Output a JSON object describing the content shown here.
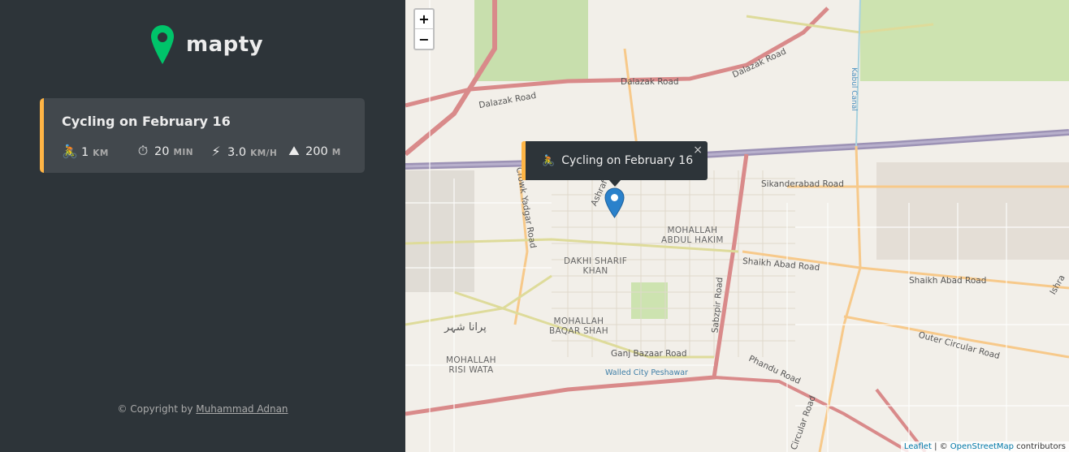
{
  "app": {
    "name": "mapty"
  },
  "workouts": [
    {
      "title": "Cycling on February 16",
      "type_icon": "🚴",
      "distance": {
        "icon": "🚴",
        "value": "1",
        "unit": "KM"
      },
      "duration": {
        "icon": "⏱",
        "value": "20",
        "unit": "MIN"
      },
      "speed": {
        "icon": "⚡",
        "value": "3.0",
        "unit": "KM/H"
      },
      "elevation": {
        "icon": "⛰",
        "value": "200",
        "unit": "M"
      }
    }
  ],
  "copyright": {
    "prefix": "© Copyright by",
    "author": "Muhammad Adnan"
  },
  "map": {
    "zoom_in": "+",
    "zoom_out": "−",
    "popup": {
      "icon": "🚴",
      "text": "Cycling on February 16",
      "close": "×"
    },
    "attribution": {
      "leaflet": "Leaflet",
      "sep": " | © ",
      "osm": "OpenStreetMap",
      "suffix": " contributors"
    },
    "labels": {
      "dalazak_road": "Dalazak Road",
      "dalazak_road_2": "Dalazak Road",
      "dalazak_road_3": "Dalazak Road",
      "kabul_canal": "Kabul Canal",
      "sikanderabad_road": "Sikanderabad Road",
      "shaikh_abad_road": "Shaikh Abad Road",
      "shaikh_abad_road_2": "Shaikh Abad Road",
      "outer_circular_road": "Outer Circular Road",
      "phandu_road": "Phandu Road",
      "ganj_bazaar_road": "Ganj Bazaar Road",
      "walled_city": "Walled City Peshawar",
      "sabzpir_road": "Sabzpir Road",
      "crown_yadgar_road": "Crowk Yadgar Road",
      "circular_road": "Circular Road",
      "mohallah_abdul_hakim": "MOHALLAH\nABDUL HAKIM",
      "dakhi_sharif_khan": "DAKHI SHARIF\nKHAN",
      "mohallah_baqar_shah": "MOHALLAH\nBAQAR SHAH",
      "mohallah_risi_wata": "MOHALLAH\nRISI WATA",
      "purana_shehr": "پرانا شہر",
      "ashraf": "Ashraf",
      "ishra": "Ishra"
    }
  },
  "colors": {
    "accent_cycling": "#ffb545",
    "brand": "#00c46a",
    "sidebar_bg": "#2d3439",
    "card_bg": "#42484d"
  }
}
